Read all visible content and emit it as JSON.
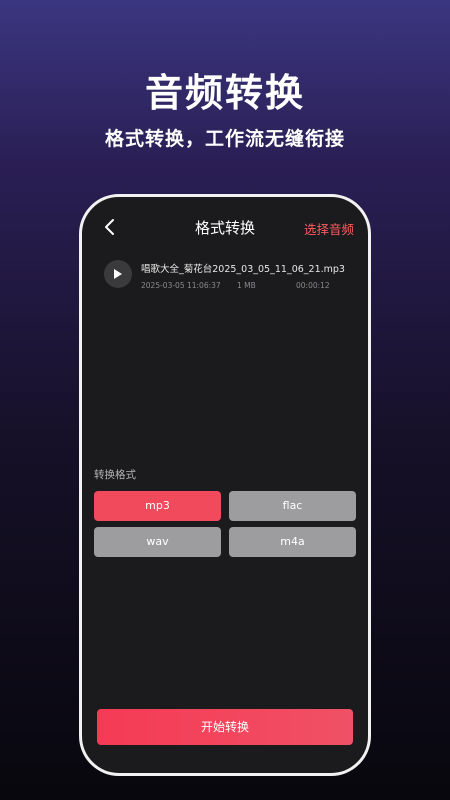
{
  "promo": {
    "title": "音频转换",
    "subtitle": "格式转换，工作流无缝衔接"
  },
  "header": {
    "back_icon": "chevron-left-icon",
    "title": "格式转换",
    "select_audio_label": "选择音频",
    "accent_color": "#ff5a5f"
  },
  "file": {
    "play_icon": "play-icon",
    "name": "唱歌大全_菊花台2025_03_05_11_06_21.mp3",
    "date": "2025-03-05 11:06:37",
    "size": "1 MB",
    "duration": "00:00:12"
  },
  "formats": {
    "label": "转换格式",
    "options": [
      {
        "label": "mp3",
        "selected": true
      },
      {
        "label": "flac",
        "selected": false
      },
      {
        "label": "wav",
        "selected": false
      },
      {
        "label": "m4a",
        "selected": false
      }
    ],
    "selected_color": "#f04a5c",
    "unselected_color": "#9d9d9f"
  },
  "action": {
    "start_label": "开始转换"
  }
}
